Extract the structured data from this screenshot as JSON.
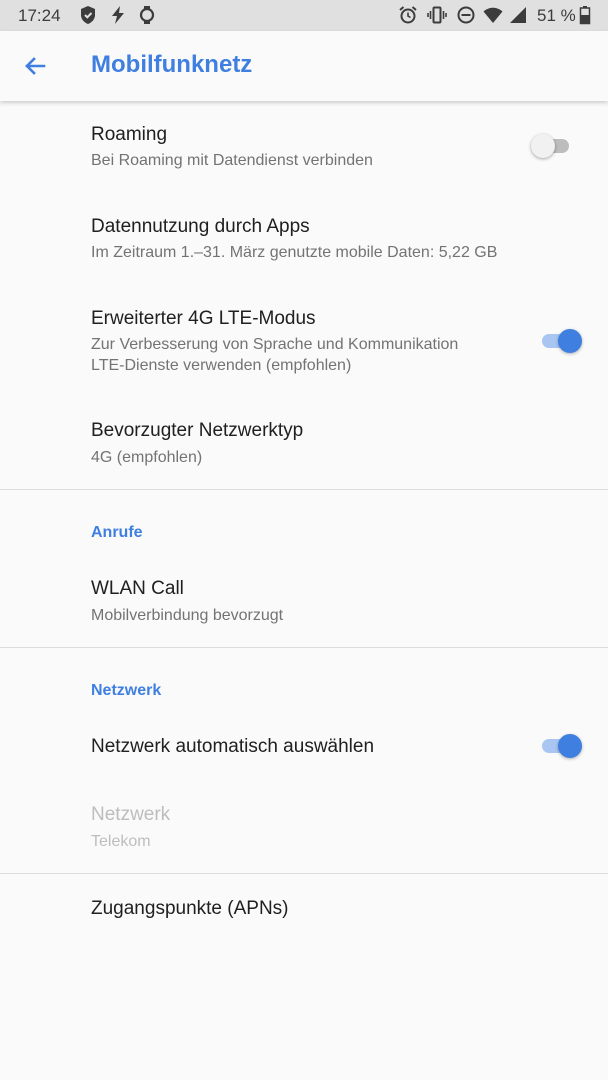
{
  "status_bar": {
    "time": "17:24",
    "battery_percent": "51 %",
    "left_icons": [
      "shield-icon",
      "flash-icon",
      "watch-icon"
    ],
    "right_icons": [
      "alarm-icon",
      "vibrate-icon",
      "dnd-icon",
      "wifi-icon",
      "signal-icon",
      "battery-icon"
    ]
  },
  "app_bar": {
    "title": "Mobilfunknetz"
  },
  "settings": {
    "roaming": {
      "title": "Roaming",
      "summary": "Bei Roaming mit Datendienst verbinden",
      "enabled": false
    },
    "data_usage": {
      "title": "Datennutzung durch Apps",
      "summary": "Im Zeitraum 1.–31. März genutzte mobile Daten: 5,22 GB"
    },
    "lte_mode": {
      "title": "Erweiterter 4G LTE-Modus",
      "summary_line1": "Zur Verbesserung von Sprache und Kommunikation",
      "summary_line2": "LTE-Dienste verwenden (empfohlen)",
      "enabled": true
    },
    "network_type": {
      "title": "Bevorzugter Netzwerktyp",
      "summary": "4G (empfohlen)"
    }
  },
  "calls": {
    "header": "Anrufe",
    "wlan_call": {
      "title": "WLAN Call",
      "summary": "Mobilverbindung bevorzugt"
    }
  },
  "network": {
    "header": "Netzwerk",
    "auto_select": {
      "title": "Netzwerk automatisch auswählen",
      "enabled": true
    },
    "operator": {
      "title": "Netzwerk",
      "summary": "Telekom",
      "disabled": true
    },
    "apn": {
      "title": "Zugangspunkte (APNs)"
    }
  },
  "colors": {
    "accent": "#3f7fe0",
    "accent_track": "#a9c6f3",
    "status_bar_bg": "#e0e0e0",
    "background": "#fafafa"
  }
}
